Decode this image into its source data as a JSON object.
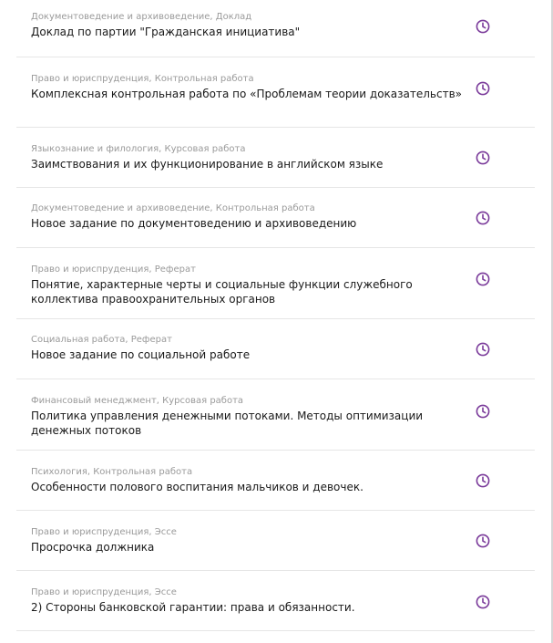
{
  "accent_color": "#7a3a9a",
  "orders": [
    {
      "meta": "Документоведение и архивоведение, Доклад",
      "title": "Доклад по партии \"Гражданская инициатива\"",
      "icon": "clock-icon"
    },
    {
      "meta": "Право и юриспруденция, Контрольная работа",
      "title": "Комплексная контрольная работа по «Проблемам теории доказательств»",
      "icon": "clock-icon"
    },
    {
      "meta": "Языкознание и филология, Курсовая работа",
      "title": "Заимствования и их функционирование в английском языке",
      "icon": "clock-icon"
    },
    {
      "meta": "Документоведение и архивоведение, Контрольная работа",
      "title": "Новое задание по документоведению и архивоведению",
      "icon": "clock-icon"
    },
    {
      "meta": "Право и юриспруденция, Реферат",
      "title": "Понятие, характерные черты и социальные функции служебного коллектива правоохранительных органов",
      "icon": "clock-icon"
    },
    {
      "meta": "Социальная работа, Реферат",
      "title": "Новое задание по социальной работе",
      "icon": "clock-icon"
    },
    {
      "meta": "Финансовый менеджмент, Курсовая работа",
      "title": "Политика управления денежными потоками. Методы оптимизации денежных потоков",
      "icon": "clock-icon"
    },
    {
      "meta": "Психология, Контрольная работа",
      "title": "Особенности полового воспитания мальчиков и девочек.",
      "icon": "clock-icon"
    },
    {
      "meta": "Право и юриспруденция, Эссе",
      "title": "Просрочка должника",
      "icon": "clock-icon"
    },
    {
      "meta": "Право и юриспруденция, Эссе",
      "title": "2) Стороны банковской гарантии: права и обязанности.",
      "icon": "clock-icon"
    }
  ]
}
